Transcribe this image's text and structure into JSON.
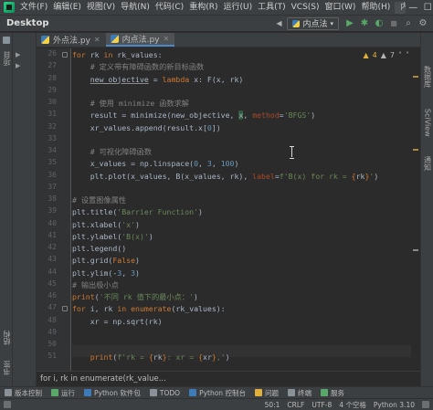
{
  "window": {
    "menu": [
      "文件(F)",
      "编辑(E)",
      "视图(V)",
      "导航(N)",
      "代码(C)",
      "重构(R)",
      "运行(U)",
      "工具(T)",
      "VCS(S)",
      "窗口(W)",
      "帮助(H)"
    ],
    "title_tab": "内点法 - ...",
    "controls": {
      "minimize": "—",
      "maximize": "☐",
      "close": "✕"
    }
  },
  "navbar": {
    "project": "Desktop",
    "run_config": "内点法",
    "icons": {
      "build": "▶",
      "run": "▶",
      "debug": "✱",
      "coverage": "◐",
      "stop": "■",
      "search": "⌕",
      "settings": "⚙"
    }
  },
  "left_strip": {
    "project_tab": "项目",
    "structure_tab": "结构",
    "bookmarks_tab": "书签"
  },
  "right_strip": {
    "database_tab": "数据库",
    "sciview_tab": "SciView",
    "notifications_tab": "通知"
  },
  "editor_tabs": [
    {
      "label": "外点法.py",
      "active": false
    },
    {
      "label": "内点法.py",
      "active": true
    }
  ],
  "inspections": {
    "warnings": "4",
    "weak_warnings": "7"
  },
  "code": {
    "line_numbers": [
      "26",
      "27",
      "28",
      "29",
      "30",
      "31",
      "32",
      "33",
      "34",
      "35",
      "36",
      "37",
      "38",
      "39",
      "40",
      "41",
      "42",
      "43",
      "44",
      "45",
      "46",
      "47",
      "48",
      "49",
      "50",
      "51"
    ],
    "lines": [
      "for rk in rk_values:",
      "    # 定义带有障碍函数的新目标函数",
      "    new_objective = lambda x: F(x, rk)",
      "",
      "    # 使用 minimize 函数求解",
      "    result = minimize(new_objective, x, method='BFGS')",
      "    xr_values.append(result.x[0])",
      "",
      "    # 可视化障碍函数",
      "    x_values = np.linspace(0, 3, 100)",
      "    plt.plot(x_values, B(x_values, rk), label=f'B(x) for rk = {rk}')",
      "",
      "# 设置图像属性",
      "plt.title('Barrier Function')",
      "plt.xlabel('x')",
      "plt.ylabel('B(x)')",
      "plt.legend()",
      "plt.grid(False)",
      "plt.ylim(-3, 3)",
      "# 输出极小点",
      "print('不同 rk 值下的最小点：')",
      "for i, rk in enumerate(rk_values):",
      "    xr = np.sqrt(rk)",
      "",
      "",
      "    print(f'rk = {rk}: xr = {xr},')"
    ]
  },
  "editor_breadcrumb": "for i, rk in enumerate(rk_value...",
  "tool_windows": [
    "版本控制",
    "运行",
    "Python 软件包",
    "TODO",
    "Python 控制台",
    "问题",
    "终端",
    "服务"
  ],
  "status": {
    "position": "50:1",
    "line_sep": "CRLF",
    "encoding": "UTF-8",
    "indent": "4 个空格",
    "interpreter": "Python 3.10"
  }
}
